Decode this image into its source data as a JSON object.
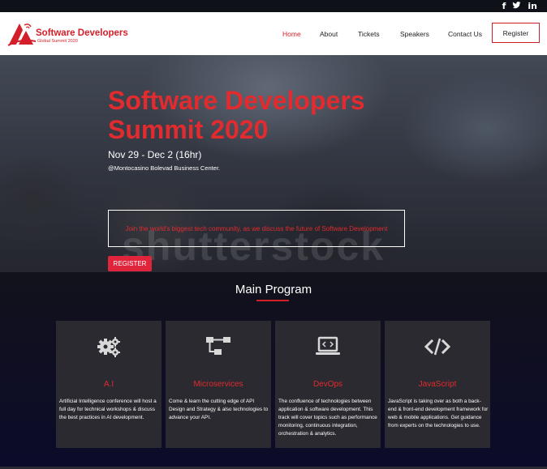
{
  "social": {
    "facebook": "f",
    "twitter": "🐦",
    "linkedin": "in"
  },
  "brand": {
    "title": "Software Developers",
    "subtitle": "Global Summit 2020",
    "color": "#d31f2a"
  },
  "nav": {
    "home": "Home",
    "about": "About",
    "tickets": "Tickets",
    "speakers": "Speakers",
    "contact": "Contact Us",
    "register": "Register"
  },
  "hero": {
    "title": "Software Developers Summit 2020",
    "date": "Nov 29 - Dec 2 (16hr)",
    "venue": "@Montocasino Bolevad Business Center.",
    "tagline": "Join the world's biggest tech community, as we discuss the future of Software Development",
    "register": "REGISTER",
    "watermark": "shutterstock"
  },
  "program": {
    "title": "Main Program",
    "cards": [
      {
        "icon": "gears-icon",
        "title": "A.I",
        "desc": "Artificial Intelligence conference will host a full day for technical workshops & discuss the best practices in AI development."
      },
      {
        "icon": "sitemap-icon",
        "title": "Microservices",
        "desc": "Come & learn the cutting edge of API Design and Strategy & also technologies to advance your API."
      },
      {
        "icon": "laptop-code-icon",
        "title": "DevOps",
        "desc": "The confluence of technologies between application & software development. This track will cover topics such as performance monitoring, continuous integration, orchestration & analytics."
      },
      {
        "icon": "code-icon",
        "title": "JavaScript",
        "desc": "JavaScript is taking over as both a back-end & front-end development framework for web & mobile applications. Get guidance from experts on the technologies to use."
      }
    ]
  }
}
